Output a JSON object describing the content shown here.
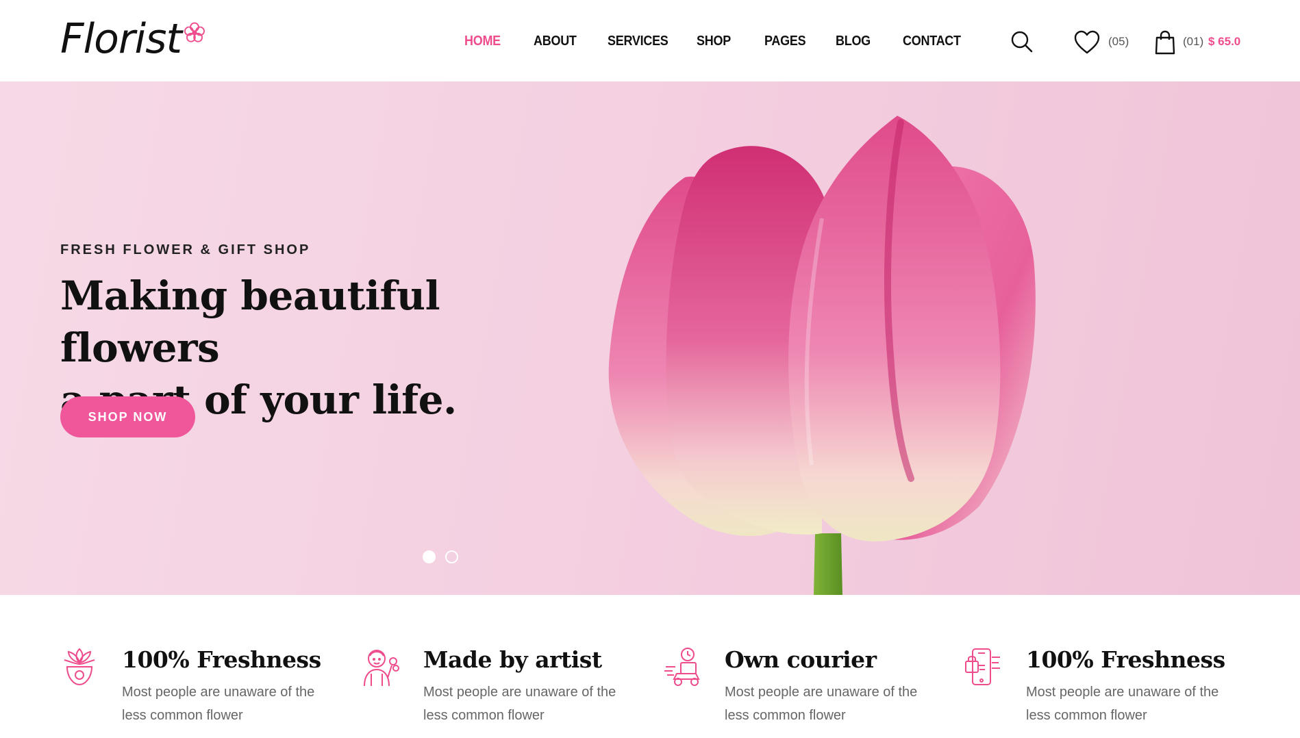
{
  "brand": {
    "name": "Florist",
    "accent_color": "#ee4c8c"
  },
  "nav": {
    "items": [
      "HOME",
      "ABOUT",
      "SERVICES",
      "SHOP",
      "PAGES",
      "BLOG",
      "CONTACT"
    ],
    "active": "HOME"
  },
  "header": {
    "search_icon": "search-icon",
    "wishlist_count": "(05)",
    "cart_count": "(01)",
    "cart_total": "$ 65.0"
  },
  "hero": {
    "subtitle": "FRESH FLOWER & GIFT SHOP",
    "title_line1": "Making beautiful flowers",
    "title_line2": "a part of your life.",
    "cta": "SHOP NOW",
    "slides_total": 2,
    "slide_active": 1
  },
  "features": [
    {
      "icon": "lotus-bowl-icon",
      "title": "100% Freshness",
      "desc_line1": "Most people are unaware of the",
      "desc_line2": "less common flower"
    },
    {
      "icon": "florist-artist-icon",
      "title": "Made by artist",
      "desc_line1": "Most people are unaware of the",
      "desc_line2": "less common flower"
    },
    {
      "icon": "courier-scooter-icon",
      "title": "Own courier",
      "desc_line1": "Most people are unaware of the",
      "desc_line2": "less common flower"
    },
    {
      "icon": "mobile-order-icon",
      "title": "100% Freshness",
      "desc_line1": "Most people are unaware of the",
      "desc_line2": "less common flower"
    }
  ]
}
